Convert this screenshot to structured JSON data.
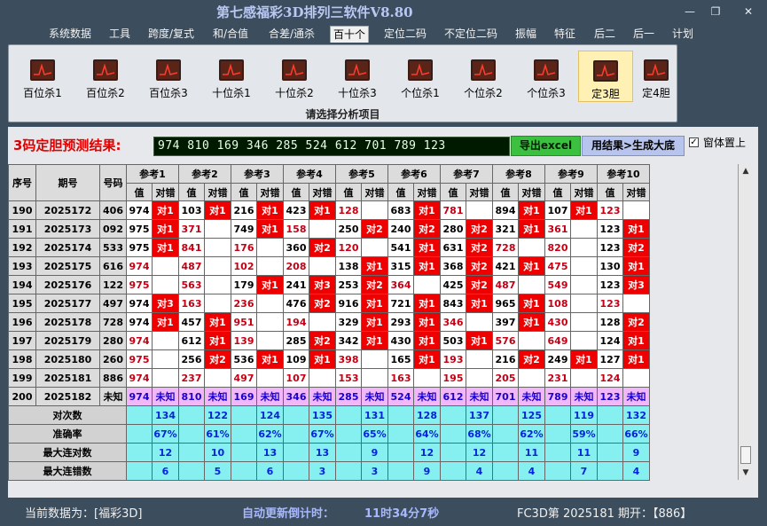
{
  "window": {
    "title": "第七感福彩3D排列三软件V8.80",
    "min_label": "—",
    "max_label": "❐",
    "close_label": "✕"
  },
  "menu": [
    "系统数据",
    "工具",
    "跨度/复式",
    "和/合值",
    "合差/通杀",
    "百十个",
    "定位二码",
    "不定位二码",
    "振幅",
    "特征",
    "后二",
    "后一",
    "计划"
  ],
  "menu_active": "百十个",
  "ribbon": {
    "buttons": [
      "百位杀1",
      "百位杀2",
      "百位杀3",
      "十位杀1",
      "十位杀2",
      "十位杀3",
      "个位杀1",
      "个位杀2",
      "个位杀3",
      "定3胆",
      "定4胆"
    ],
    "selected": "定3胆",
    "caption": "请选择分析项目",
    "icon": "chart-icon"
  },
  "prediction": {
    "label": "3码定胆预测结果:",
    "value": "974 810 169 346 285 524 612 701 789 123",
    "export_label": "导出excel",
    "generate_label": "用结果>生成大底",
    "pin_label": "窗体置上",
    "pin_checked": true,
    "check_mark": "✓"
  },
  "table": {
    "head_seq": "序号",
    "head_period": "期号",
    "head_number": "号码",
    "sub_value": "值",
    "sub_check": "对错",
    "refs": [
      "参考1",
      "参考2",
      "参考3",
      "参考4",
      "参考5",
      "参考6",
      "参考7",
      "参考8",
      "参考9",
      "参考10"
    ],
    "rows": [
      {
        "seq": "190",
        "period": "2025172",
        "num": "406",
        "cells": [
          [
            "974",
            "对1"
          ],
          [
            "103",
            "对1"
          ],
          [
            "216",
            "对1"
          ],
          [
            "423",
            "对1"
          ],
          [
            "128",
            ""
          ],
          [
            "683",
            "对1"
          ],
          [
            "781",
            ""
          ],
          [
            "894",
            "对1"
          ],
          [
            "107",
            "对1"
          ],
          [
            "123",
            ""
          ]
        ]
      },
      {
        "seq": "191",
        "period": "2025173",
        "num": "092",
        "cells": [
          [
            "975",
            "对1"
          ],
          [
            "371",
            ""
          ],
          [
            "749",
            "对1"
          ],
          [
            "158",
            ""
          ],
          [
            "250",
            "对2"
          ],
          [
            "240",
            "对2"
          ],
          [
            "280",
            "对2"
          ],
          [
            "321",
            "对1"
          ],
          [
            "361",
            ""
          ],
          [
            "123",
            "对1"
          ]
        ]
      },
      {
        "seq": "192",
        "period": "2025174",
        "num": "533",
        "cells": [
          [
            "975",
            "对1"
          ],
          [
            "841",
            ""
          ],
          [
            "176",
            ""
          ],
          [
            "360",
            "对2"
          ],
          [
            "120",
            ""
          ],
          [
            "541",
            "对1"
          ],
          [
            "631",
            "对2"
          ],
          [
            "728",
            ""
          ],
          [
            "820",
            ""
          ],
          [
            "123",
            "对2"
          ]
        ]
      },
      {
        "seq": "193",
        "period": "2025175",
        "num": "616",
        "cells": [
          [
            "974",
            ""
          ],
          [
            "487",
            ""
          ],
          [
            "102",
            ""
          ],
          [
            "208",
            ""
          ],
          [
            "138",
            "对1"
          ],
          [
            "315",
            "对1"
          ],
          [
            "368",
            "对2"
          ],
          [
            "421",
            "对1"
          ],
          [
            "475",
            ""
          ],
          [
            "130",
            "对1"
          ]
        ]
      },
      {
        "seq": "194",
        "period": "2025176",
        "num": "122",
        "cells": [
          [
            "975",
            ""
          ],
          [
            "563",
            ""
          ],
          [
            "179",
            "对1"
          ],
          [
            "241",
            "对3"
          ],
          [
            "253",
            "对2"
          ],
          [
            "364",
            ""
          ],
          [
            "425",
            "对2"
          ],
          [
            "487",
            ""
          ],
          [
            "549",
            ""
          ],
          [
            "123",
            "对3"
          ]
        ]
      },
      {
        "seq": "195",
        "period": "2025177",
        "num": "497",
        "cells": [
          [
            "974",
            "对3"
          ],
          [
            "163",
            ""
          ],
          [
            "236",
            ""
          ],
          [
            "476",
            "对2"
          ],
          [
            "916",
            "对1"
          ],
          [
            "721",
            "对1"
          ],
          [
            "843",
            "对1"
          ],
          [
            "965",
            "对1"
          ],
          [
            "108",
            ""
          ],
          [
            "123",
            ""
          ]
        ]
      },
      {
        "seq": "196",
        "period": "2025178",
        "num": "728",
        "cells": [
          [
            "974",
            "对1"
          ],
          [
            "457",
            "对1"
          ],
          [
            "951",
            ""
          ],
          [
            "194",
            ""
          ],
          [
            "329",
            "对1"
          ],
          [
            "293",
            "对1"
          ],
          [
            "346",
            ""
          ],
          [
            "397",
            "对1"
          ],
          [
            "430",
            ""
          ],
          [
            "128",
            "对2"
          ]
        ]
      },
      {
        "seq": "197",
        "period": "2025179",
        "num": "280",
        "cells": [
          [
            "974",
            ""
          ],
          [
            "612",
            "对1"
          ],
          [
            "139",
            ""
          ],
          [
            "285",
            "对2"
          ],
          [
            "342",
            "对1"
          ],
          [
            "430",
            "对1"
          ],
          [
            "503",
            "对1"
          ],
          [
            "576",
            ""
          ],
          [
            "649",
            ""
          ],
          [
            "124",
            "对1"
          ]
        ]
      },
      {
        "seq": "198",
        "period": "2025180",
        "num": "260",
        "cells": [
          [
            "975",
            ""
          ],
          [
            "256",
            "对2"
          ],
          [
            "536",
            "对1"
          ],
          [
            "109",
            "对1"
          ],
          [
            "398",
            ""
          ],
          [
            "165",
            "对1"
          ],
          [
            "193",
            ""
          ],
          [
            "216",
            "对2"
          ],
          [
            "249",
            "对1"
          ],
          [
            "127",
            "对1"
          ]
        ]
      },
      {
        "seq": "199",
        "period": "2025181",
        "num": "886",
        "cells": [
          [
            "974",
            ""
          ],
          [
            "237",
            ""
          ],
          [
            "497",
            ""
          ],
          [
            "107",
            ""
          ],
          [
            "153",
            ""
          ],
          [
            "163",
            ""
          ],
          [
            "195",
            ""
          ],
          [
            "205",
            ""
          ],
          [
            "231",
            ""
          ],
          [
            "124",
            ""
          ]
        ]
      },
      {
        "seq": "200",
        "period": "2025182",
        "num": "未知",
        "cells": [
          [
            "974",
            "未知"
          ],
          [
            "810",
            "未知"
          ],
          [
            "169",
            "未知"
          ],
          [
            "346",
            "未知"
          ],
          [
            "285",
            "未知"
          ],
          [
            "524",
            "未知"
          ],
          [
            "612",
            "未知"
          ],
          [
            "701",
            "未知"
          ],
          [
            "789",
            "未知"
          ],
          [
            "123",
            "未知"
          ]
        ]
      }
    ],
    "stats": [
      {
        "label": "对次数",
        "values": [
          "134",
          "122",
          "124",
          "135",
          "131",
          "128",
          "137",
          "125",
          "119",
          "132"
        ]
      },
      {
        "label": "准确率",
        "values": [
          "67%",
          "61%",
          "62%",
          "67%",
          "65%",
          "64%",
          "68%",
          "62%",
          "59%",
          "66%"
        ]
      },
      {
        "label": "最大连对数",
        "values": [
          "12",
          "10",
          "13",
          "13",
          "9",
          "12",
          "12",
          "11",
          "11",
          "9"
        ]
      },
      {
        "label": "最大连错数",
        "values": [
          "6",
          "5",
          "6",
          "3",
          "3",
          "9",
          "4",
          "4",
          "7",
          "4"
        ]
      }
    ]
  },
  "status": {
    "current_data": "当前数据为：[福彩3D]",
    "countdown_label": "自动更新倒计时：",
    "countdown_value": "11时34分7秒",
    "period_info": "FC3D第 2025181 期开：【886】"
  },
  "colors": {
    "hit": "#ee0000",
    "miss_text": "#c30014",
    "unknown_row": "#f2b7f8",
    "stat_cell": "#86f0f0",
    "accent_title": "#b9c8f2"
  }
}
